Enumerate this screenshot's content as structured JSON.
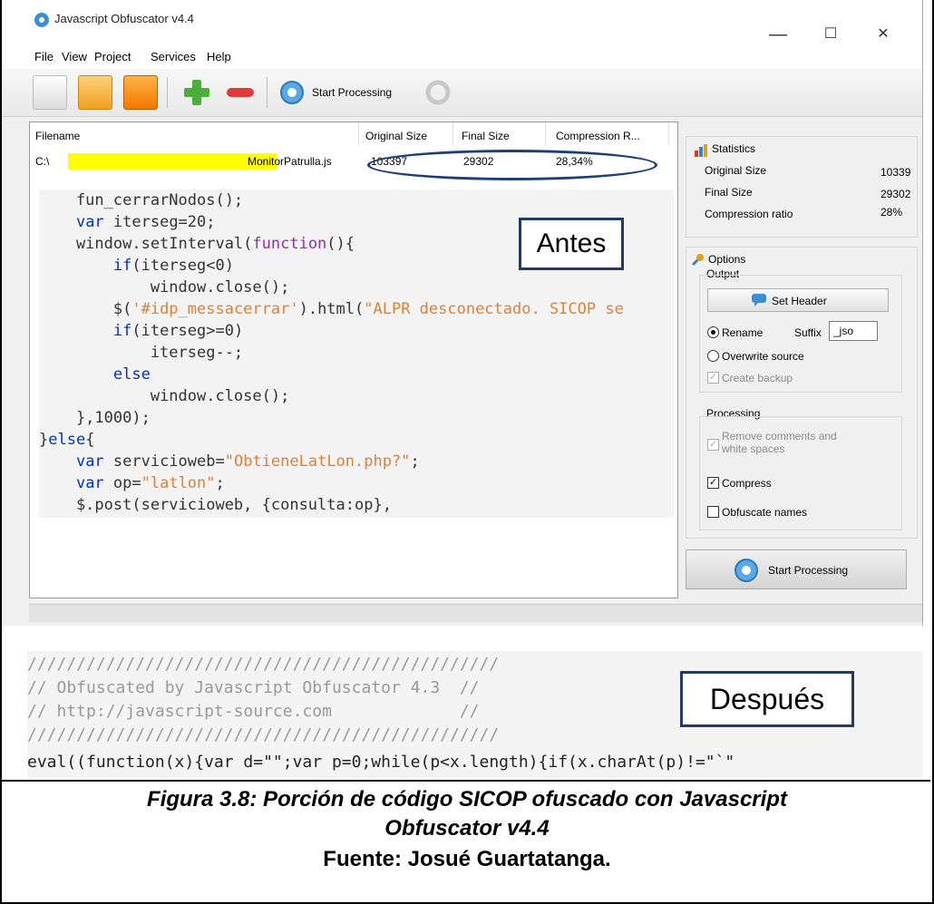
{
  "window": {
    "title": "Javascript Obfuscator v4.4",
    "minimize": "—",
    "maximize": "☐",
    "close": "✕"
  },
  "menu": [
    "File",
    "View",
    "Project",
    "Services",
    "Help"
  ],
  "toolbar": {
    "start_label": "Start Processing"
  },
  "table": {
    "columns": [
      "Filename",
      "Original Size",
      "Final Size",
      "Compression R..."
    ],
    "row": {
      "filename_prefix": "C:\\",
      "filename_suffix": "MonitorPatrulla.js",
      "original": "103397",
      "final": "29302",
      "ratio": "28,34%"
    }
  },
  "code_before": {
    "lines": [
      "    fun_cerrarNodos();",
      "    var iterseg=20;",
      "    window.setInterval(function(){",
      "        if(iterseg<0)",
      "            window.close();",
      "        $('#idp_messacerrar').html(\"ALPR desconectado. SICOP se",
      "        if(iterseg>=0)",
      "            iterseg--;",
      "        else",
      "            window.close();",
      "    },1000);",
      "}else{",
      "    var servicioweb=\"ObtieneLatLon.php?\";",
      "    var op=\"latlon\";",
      "    $.post(servicioweb, {consulta:op},"
    ]
  },
  "annotation_before": "Antes",
  "statistics": {
    "title": "Statistics",
    "rows": [
      {
        "label": "Original Size",
        "value": "10339"
      },
      {
        "label": "Final Size",
        "value": "29302"
      },
      {
        "label": "Compression ratio",
        "value": "28%"
      }
    ]
  },
  "options": {
    "title": "Options",
    "output_label": "Output",
    "set_header": "Set Header",
    "rename": "Rename",
    "suffix_label": "Suffix",
    "suffix_value": "_jso",
    "overwrite": "Overwrite source",
    "create_backup": "Create backup",
    "processing_label": "Processing",
    "remove_comments_1": "Remove comments and",
    "remove_comments_2": "white spaces",
    "compress": "Compress",
    "obfuscate": "Obfuscate names",
    "start_button": "Start Processing"
  },
  "code_after": {
    "lines": [
      "////////////////////////////////////////////////",
      "// Obfuscated by Javascript Obfuscator 4.3  //",
      "// http://javascript-source.com             //",
      "////////////////////////////////////////////////"
    ],
    "eval_line": "eval((function(x){var d=\"\";var p=0;while(p<x.length){if(x.charAt(p)!=\"`\""
  },
  "annotation_after": "Después",
  "caption": {
    "line1": "Figura 3.8: Porción de código SICOP ofuscado con Javascript",
    "line2": "Obfuscator v4.4",
    "source": "Fuente: Josué Guartatanga."
  }
}
